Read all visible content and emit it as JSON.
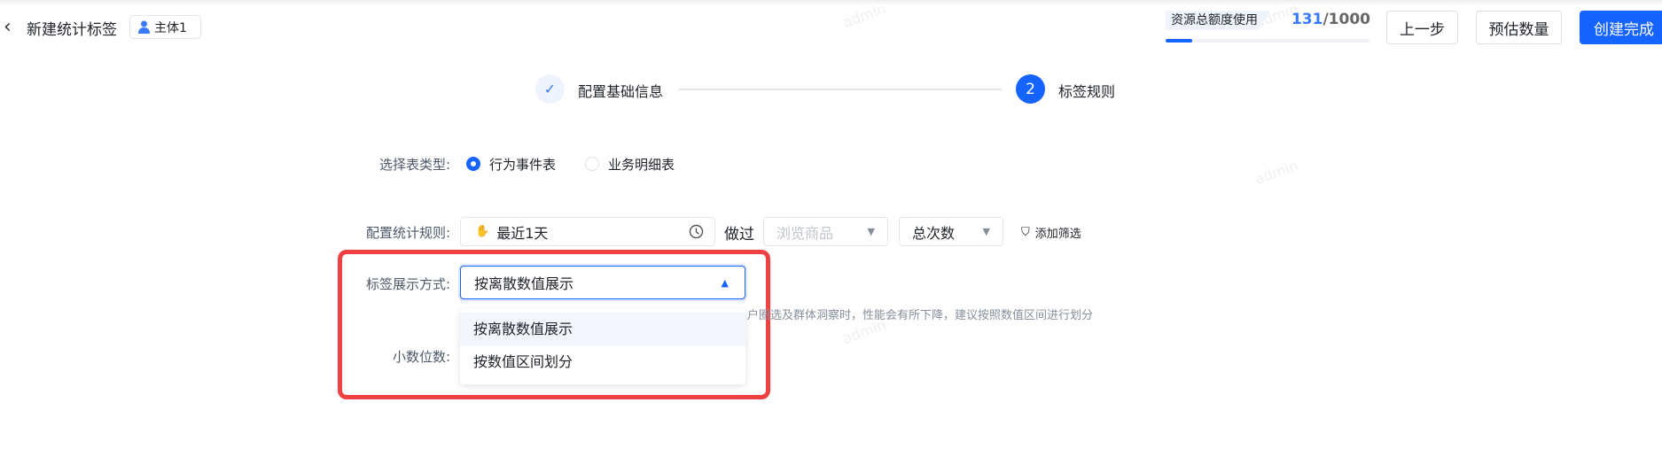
{
  "header": {
    "title": "新建统计标签",
    "entity_badge": "主体1",
    "quota_label": "资源总额度使用",
    "quota_used": "131",
    "quota_total": "/1000",
    "quota_fraction": 0.131,
    "buttons": {
      "prev": "上一步",
      "estimate": "预估数量",
      "finish": "创建完成"
    }
  },
  "steps": [
    {
      "label": "配置基础信息",
      "status": "done"
    },
    {
      "number": "2",
      "label": "标签规则",
      "status": "active"
    }
  ],
  "form": {
    "table_type": {
      "label": "选择表类型:",
      "options": [
        "行为事件表",
        "业务明细表"
      ],
      "selected": "行为事件表"
    },
    "rule": {
      "label": "配置统计规则:",
      "time": "最近1天",
      "did": "做过",
      "event_placeholder": "浏览商品",
      "metric": "总次数",
      "add_filter": "添加筛选"
    },
    "display": {
      "label": "标签展示方式:",
      "value": "按离散数值展示",
      "hint": "户圈选及群体洞察时，性能会有所下降，建议按照数值区间进行划分",
      "options": [
        "按离散数值展示",
        "按数值区间划分"
      ]
    },
    "decimals": {
      "label": "小数位数:"
    }
  },
  "watermark": "admin",
  "colors": {
    "primary": "#1664ff",
    "highlight": "#f04142"
  }
}
